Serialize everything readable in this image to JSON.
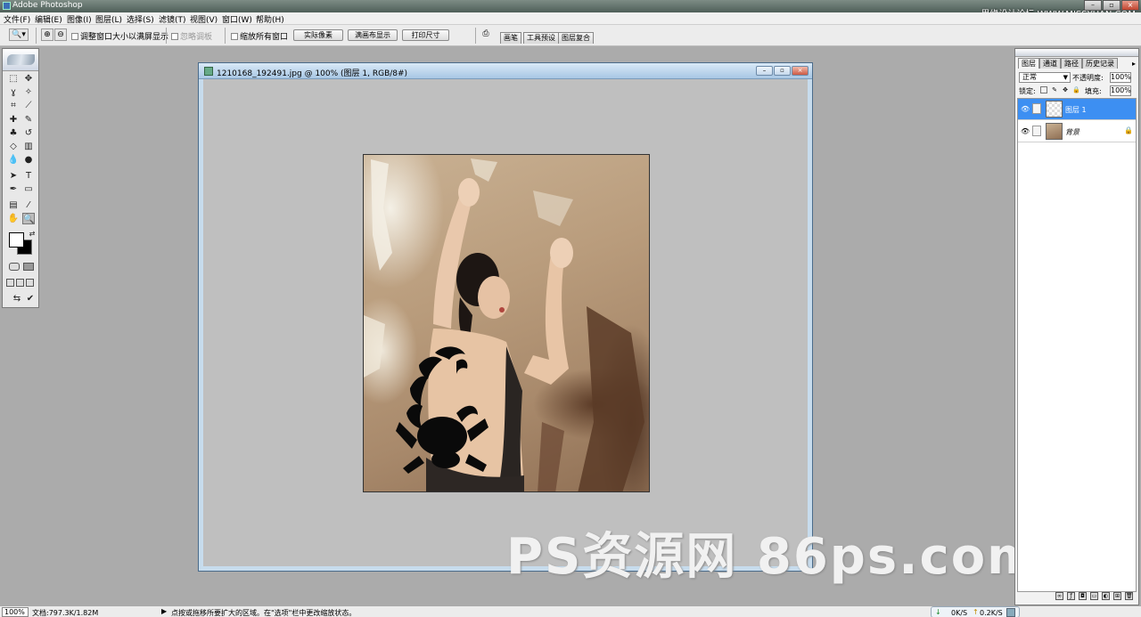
{
  "window": {
    "title": "Adobe Photoshop",
    "top_watermark": "思缘设计论坛  WWW.MISSYUAN.COM"
  },
  "menu": [
    {
      "label": "文件(F)"
    },
    {
      "label": "编辑(E)"
    },
    {
      "label": "图像(I)"
    },
    {
      "label": "图层(L)"
    },
    {
      "label": "选择(S)"
    },
    {
      "label": "滤镜(T)"
    },
    {
      "label": "视图(V)"
    },
    {
      "label": "窗口(W)"
    },
    {
      "label": "帮助(H)"
    }
  ],
  "options": {
    "resize_windows": "调整窗口大小以满屏显示",
    "ignore_palettes": "忽略调板",
    "zoom_all": "缩放所有窗口",
    "actual_pixels": "实际像素",
    "fit_screen": "满画布显示",
    "print_size": "打印尺寸",
    "well_tabs": [
      "画笔",
      "工具预设",
      "图层复合"
    ]
  },
  "document": {
    "title": "1210168_192491.jpg @ 100% (图层 1, RGB/8#)",
    "buttons": {
      "minimize": "–",
      "restore": "▫",
      "close": "×"
    }
  },
  "watermark": "PS资源网 86ps.com",
  "layers_panel": {
    "tabs": [
      "图层",
      "通道",
      "路径",
      "历史记录"
    ],
    "blend_mode": "正常",
    "opacity_label": "不透明度:",
    "opacity_value": "100%",
    "lock_label": "锁定:",
    "fill_label": "填充:",
    "fill_value": "100%",
    "layers": [
      {
        "name": "图层 1",
        "selected": true
      },
      {
        "name": "背景",
        "selected": false,
        "locked": true
      }
    ]
  },
  "status": {
    "zoom": "100%",
    "doc_size": "文档:797.3K/1.82M",
    "hint": "点按或拖移所要扩大的区域。在\"选项\"栏中更改缩放状态。",
    "download": "0K/S",
    "upload": "0.2K/S"
  },
  "colors": {
    "selected_layer": "#3d8ff2",
    "canvas_bg": "#bfbfbf",
    "workspace": "#ababab"
  }
}
